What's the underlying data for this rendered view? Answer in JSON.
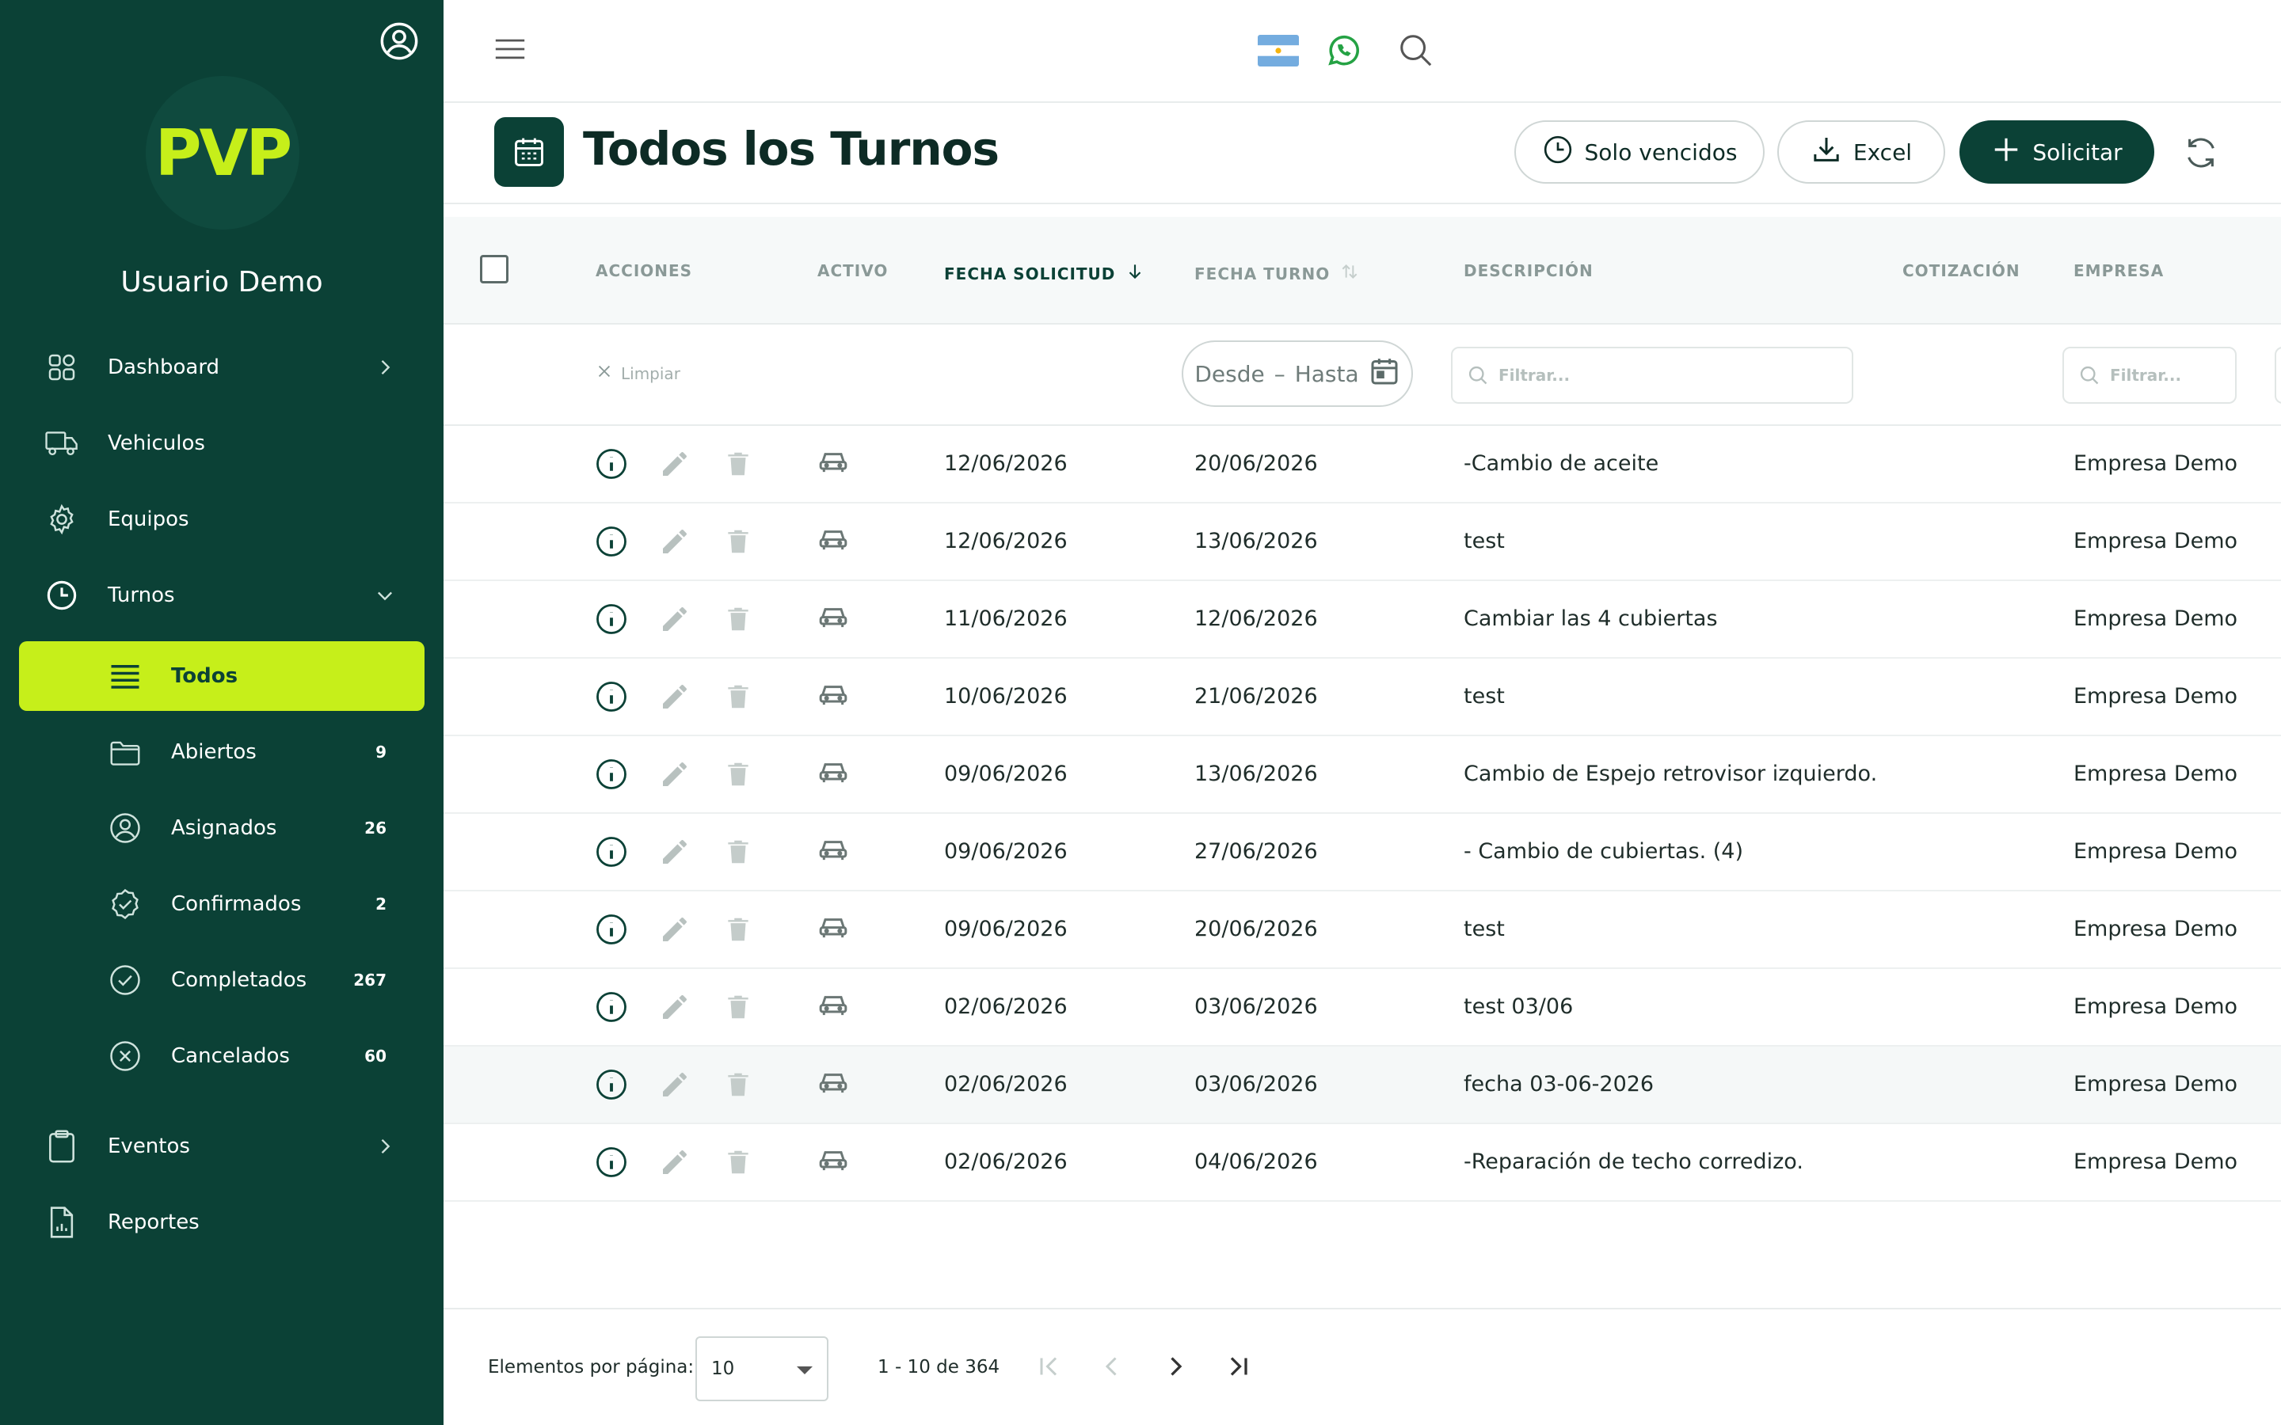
{
  "sidebar": {
    "logo": "PVP",
    "user_name": "Usuario Demo",
    "items": [
      {
        "label": "Dashboard",
        "icon": "grid-icon",
        "chevron": "right"
      },
      {
        "label": "Vehiculos",
        "icon": "truck-icon"
      },
      {
        "label": "Equipos",
        "icon": "gear-icon"
      },
      {
        "label": "Turnos",
        "icon": "clock-icon",
        "chevron": "down"
      },
      {
        "label": "Eventos",
        "icon": "clipboard-icon",
        "chevron": "right"
      },
      {
        "label": "Reportes",
        "icon": "report-icon"
      }
    ],
    "subitems": [
      {
        "label": "Todos",
        "icon": "list-icon",
        "count": ""
      },
      {
        "label": "Abiertos",
        "icon": "folder-icon",
        "count": "9"
      },
      {
        "label": "Asignados",
        "icon": "user-circle-icon",
        "count": "26"
      },
      {
        "label": "Confirmados",
        "icon": "badge-check-icon",
        "count": "2"
      },
      {
        "label": "Completados",
        "icon": "check-circle-icon",
        "count": "267"
      },
      {
        "label": "Cancelados",
        "icon": "x-circle-icon",
        "count": "60"
      }
    ]
  },
  "header": {
    "title": "Todos los Turnos",
    "buttons": {
      "solo_vencidos": "Solo vencidos",
      "excel": "Excel",
      "solicitar": "Solicitar"
    }
  },
  "table": {
    "columns": {
      "acciones": "ACCIONES",
      "activo": "ACTIVO",
      "fecha_solicitud": "FECHA SOLICITUD",
      "fecha_turno": "FECHA TURNO",
      "descripcion": "DESCRIPCIÓN",
      "cotizacion": "COTIZACIÓN",
      "empresa": "EMPRESA"
    },
    "filters": {
      "clear": "Limpiar",
      "date_from": "Desde",
      "date_sep": "–",
      "date_to": "Hasta",
      "placeholder": "Filtrar..."
    },
    "rows": [
      {
        "fecha_solicitud": "12/06/2026",
        "fecha_turno": "20/06/2026",
        "descripcion": "-Cambio de aceite",
        "empresa": "Empresa Demo"
      },
      {
        "fecha_solicitud": "12/06/2026",
        "fecha_turno": "13/06/2026",
        "descripcion": "test",
        "empresa": "Empresa Demo"
      },
      {
        "fecha_solicitud": "11/06/2026",
        "fecha_turno": "12/06/2026",
        "descripcion": "Cambiar las 4 cubiertas",
        "empresa": "Empresa Demo"
      },
      {
        "fecha_solicitud": "10/06/2026",
        "fecha_turno": "21/06/2026",
        "descripcion": "test",
        "empresa": "Empresa Demo"
      },
      {
        "fecha_solicitud": "09/06/2026",
        "fecha_turno": "13/06/2026",
        "descripcion": "Cambio de Espejo retrovisor izquierdo.",
        "empresa": "Empresa Demo"
      },
      {
        "fecha_solicitud": "09/06/2026",
        "fecha_turno": "27/06/2026",
        "descripcion": "- Cambio de cubiertas. (4)",
        "empresa": "Empresa Demo"
      },
      {
        "fecha_solicitud": "09/06/2026",
        "fecha_turno": "20/06/2026",
        "descripcion": "test",
        "empresa": "Empresa Demo"
      },
      {
        "fecha_solicitud": "02/06/2026",
        "fecha_turno": "03/06/2026",
        "descripcion": "test 03/06",
        "empresa": "Empresa Demo"
      },
      {
        "fecha_solicitud": "02/06/2026",
        "fecha_turno": "03/06/2026",
        "descripcion": "fecha 03-06-2026",
        "empresa": "Empresa Demo"
      },
      {
        "fecha_solicitud": "02/06/2026",
        "fecha_turno": "04/06/2026",
        "descripcion": "-Reparación de techo corredizo.",
        "empresa": "Empresa Demo"
      }
    ]
  },
  "paginator": {
    "label": "Elementos por página:",
    "page_size": "10",
    "range": "1 - 10 de 364"
  },
  "colors": {
    "sidebar_bg": "#0b4136",
    "accent_lime": "#c6ef1a",
    "primary_dark": "#0b4136"
  }
}
